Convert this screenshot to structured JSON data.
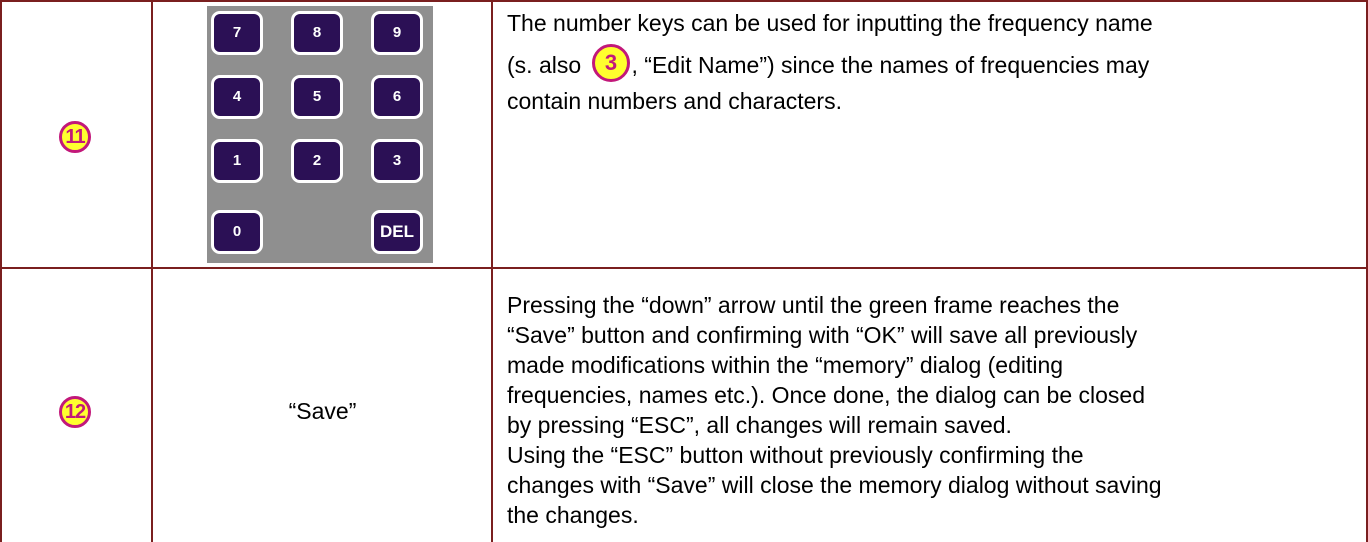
{
  "rows": [
    {
      "badge": "11",
      "keypad": {
        "keys": [
          "7",
          "8",
          "9",
          "4",
          "5",
          "6",
          "1",
          "2",
          "3",
          "0",
          "DEL"
        ]
      },
      "description": {
        "line1": "The number keys can be used for inputting the frequency name",
        "line2_prefix": "(s. also",
        "inline_badge": "3",
        "line2_suffix": ", “Edit Name”) since the names of frequencies may",
        "line3": "contain numbers and characters."
      }
    },
    {
      "badge": "12",
      "label": "“Save”",
      "description": {
        "lines": [
          "Pressing the “down” arrow until the green frame reaches the",
          "“Save” button and confirming with “OK” will save all previously",
          "made modifications within the “memory” dialog (editing",
          "frequencies, names etc.). Once done, the dialog can be closed",
          "by pressing “ESC”, all changes will remain saved.",
          "Using the “ESC” button without previously confirming the",
          "changes with “Save” will close the memory dialog without saving",
          "the changes."
        ]
      }
    }
  ],
  "colors": {
    "border": "#7a1f1f",
    "badge_fill": "#ffff2e",
    "badge_ring": "#c2187a",
    "key_fill": "#2b1055",
    "keypad_bg": "#8f8f8f"
  }
}
